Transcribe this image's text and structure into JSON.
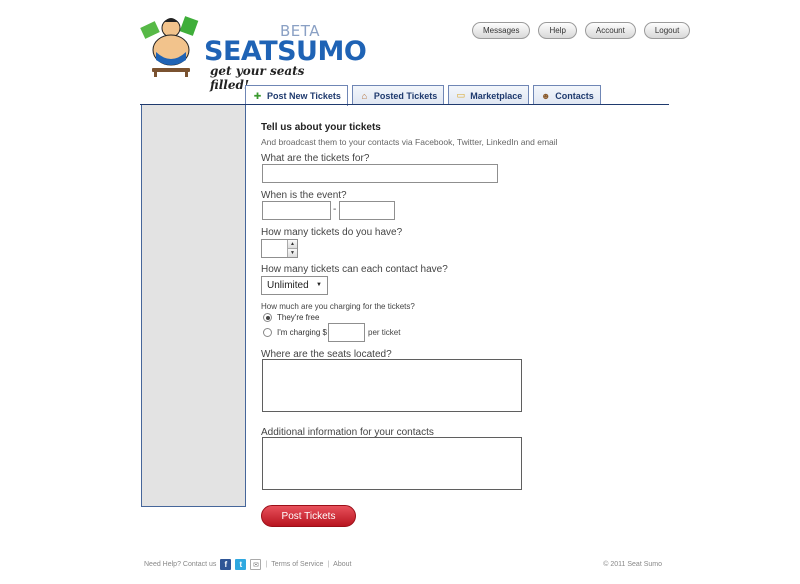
{
  "brand": {
    "name_part1": "SEAT",
    "name_part2": "SUMO",
    "beta": "BETA",
    "tagline": "get your seats filled!"
  },
  "topnav": {
    "messages": "Messages",
    "help": "Help",
    "account": "Account",
    "logout": "Logout"
  },
  "tabs": [
    {
      "label": "Post New Tickets",
      "icon": "add-ticket-icon"
    },
    {
      "label": "Posted Tickets",
      "icon": "home-icon"
    },
    {
      "label": "Marketplace",
      "icon": "chat-icon"
    },
    {
      "label": "Contacts",
      "icon": "people-icon"
    }
  ],
  "form": {
    "title": "Tell us about your tickets",
    "subtitle": "And broadcast them to your contacts via Facebook, Twitter, LinkedIn and email",
    "tickets_for_label": "What are the tickets for?",
    "tickets_for_value": "",
    "event_label": "When is the event?",
    "event_date_value": "",
    "event_time_value": "",
    "event_separator": "-",
    "count_label": "How many tickets do you have?",
    "count_value": "",
    "per_contact_label": "How many tickets can each contact have?",
    "per_contact_value": "Unlimited",
    "charging_label": "How much are you charging for the tickets?",
    "free_option": "They're free",
    "charging_option": "I'm charging $",
    "price_value": "",
    "per_ticket": "per ticket",
    "seats_label": "Where are the seats located?",
    "seats_value": "",
    "additional_label": "Additional information for your contacts",
    "additional_value": "",
    "submit_label": "Post Tickets"
  },
  "footer": {
    "need_help": "Need Help? Contact us",
    "separator": "|",
    "terms": "Terms of Service",
    "about": "About",
    "copyright": "© 2011 Seat Sumo"
  },
  "colors": {
    "brand_blue": "#1f63b5",
    "tab_border": "#6f86b5",
    "sidebar_bg": "#e3e3e3",
    "submit_red": "#c8202b"
  }
}
